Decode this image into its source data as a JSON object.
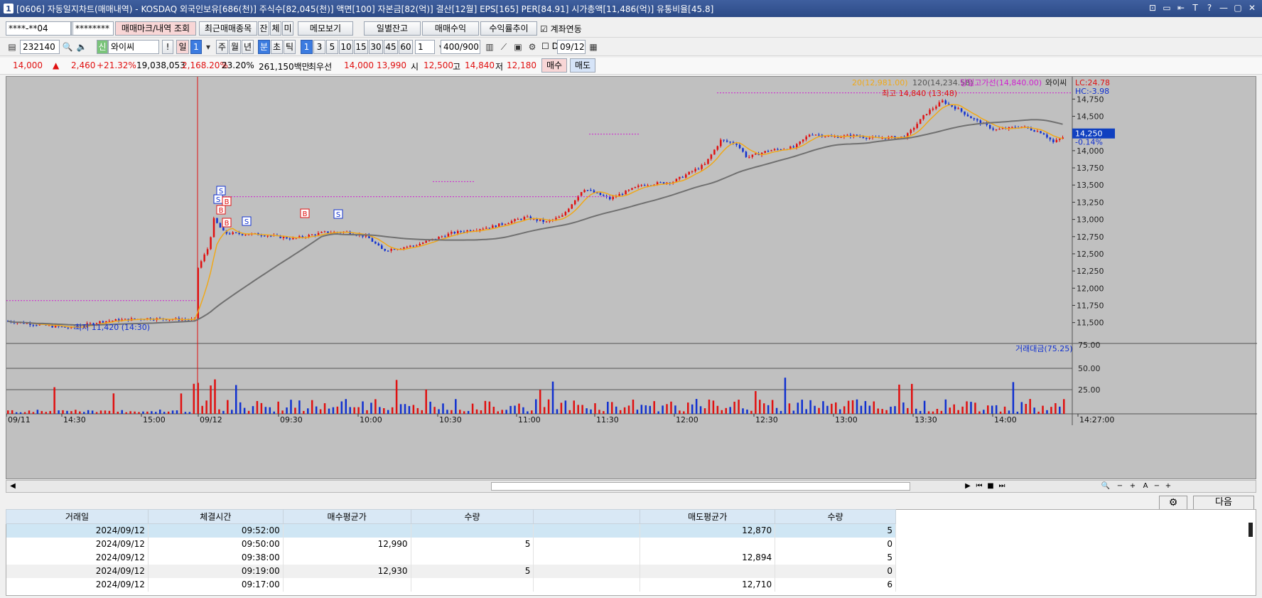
{
  "window": {
    "badge": "1",
    "title": "[0606] 자동일지차트(매매내역) - KOSDAQ 외국인보유[686(천)] 주식수[82,045(천)] 액면[100] 자본금[82(억)] 결산[12월] EPS[165] PER[84.91] 시가총액[11,486(억)] 유통비율[45.8]",
    "buttons": [
      "⊡",
      "▭",
      "⇤",
      "T",
      "?",
      "—",
      "▢",
      "✕"
    ]
  },
  "toolbar1": {
    "account": "****-**04",
    "password": "********",
    "btn_marks": "매매마크/내역 조회",
    "btn_recent": "최근매매종목",
    "btn_jan": "잔",
    "btn_che": "체",
    "btn_mi": "미",
    "btn_memo": "메모보기",
    "btn_daily": "일별잔고",
    "btn_profit": "매매수익",
    "btn_return": "수익률추이",
    "chk_link": "계좌연동"
  },
  "toolbar2": {
    "code": "232140",
    "badge_sin": "신",
    "name": "와이씨",
    "excl": "!",
    "day": "일",
    "daynum": "1",
    "periods": [
      "주",
      "월",
      "년",
      "분",
      "초",
      "틱"
    ],
    "selected_period": "분",
    "intervals": [
      "1",
      "3",
      "5",
      "10",
      "15",
      "30",
      "45",
      "60"
    ],
    "selected_interval": "1",
    "sel_count": "1",
    "range": "400/900",
    "d_label": "D",
    "date": "09/12"
  },
  "quote": {
    "price": "14,000",
    "change": "2,460",
    "change_pct": "+21.32%",
    "volume": "19,038,053",
    "vol_ratio": "2,168.20%",
    "turnover": "23.20%",
    "amount": "261,150백만",
    "best_label": "최우선",
    "ask": "14,000",
    "bid": "13,990",
    "open_label": "시",
    "open": "12,500",
    "high_label": "고",
    "high": "14,840",
    "low_label": "저",
    "low": "12,180",
    "buy_btn": "매수",
    "sell_btn": "매도"
  },
  "chart_data": {
    "type": "candlestick",
    "colors": {
      "up": "#e01010",
      "down": "#1030d0",
      "ma20": "#f0a818",
      "ma120": "#707070",
      "background": "#c0c0c0"
    },
    "legend": {
      "ma20": "20(12,981.00)",
      "ma120": "120(14,234.58)",
      "day_high_line": "당일고가선(14,840.00)",
      "name": "와이씨",
      "lc": "LC:24.78",
      "hc": "HC:-3.98",
      "volume_legend": "거래대금(75.25)"
    },
    "annotations": {
      "high": "최고 14,840 (13:48)",
      "low": "최저 11,420 (14:30)",
      "current_price": "14,250",
      "current_change": "-0.14%"
    },
    "trade_marks": [
      {
        "type": "S",
        "time": "09:38"
      },
      {
        "type": "B",
        "time": "09:19"
      },
      {
        "type": "S",
        "time": "09:52"
      },
      {
        "type": "B",
        "time": "09:50"
      },
      {
        "type": "S",
        "time": "09:17"
      }
    ],
    "y_ticks": [
      "14,750",
      "14,500",
      "14,250",
      "14,000",
      "13,750",
      "13,500",
      "13,250",
      "13,000",
      "12,750",
      "12,500",
      "12,250",
      "12,000",
      "11,750",
      "11,500"
    ],
    "y_range": [
      11300,
      14950
    ],
    "vol_ticks": [
      "75.00",
      "50.00",
      "25.00"
    ],
    "x_labels": [
      "09/11",
      "14:30",
      "15:00",
      "09/12",
      "09:30",
      "10:00",
      "10:30",
      "11:00",
      "11:30",
      "12:00",
      "12:30",
      "13:00",
      "13:30",
      "14:00",
      "14:27:00"
    ],
    "prev_close_line": 11820
  },
  "grid": {
    "headers": [
      "거래일",
      "체결시간",
      "매수평균가",
      "수량",
      "",
      "매도평균가",
      "수량"
    ],
    "rows": [
      [
        "2024/09/12",
        "09:52:00",
        "",
        "",
        "",
        "12,870",
        "5"
      ],
      [
        "2024/09/12",
        "09:50:00",
        "12,990",
        "5",
        "",
        "",
        "0"
      ],
      [
        "2024/09/12",
        "09:38:00",
        "",
        "",
        "",
        "12,894",
        "5"
      ],
      [
        "2024/09/12",
        "09:19:00",
        "12,930",
        "5",
        "",
        "",
        "0"
      ],
      [
        "2024/09/12",
        "09:17:00",
        "",
        "",
        "",
        "12,710",
        "6"
      ]
    ],
    "next_btn": "다음",
    "gear_icon": "gear-icon"
  }
}
